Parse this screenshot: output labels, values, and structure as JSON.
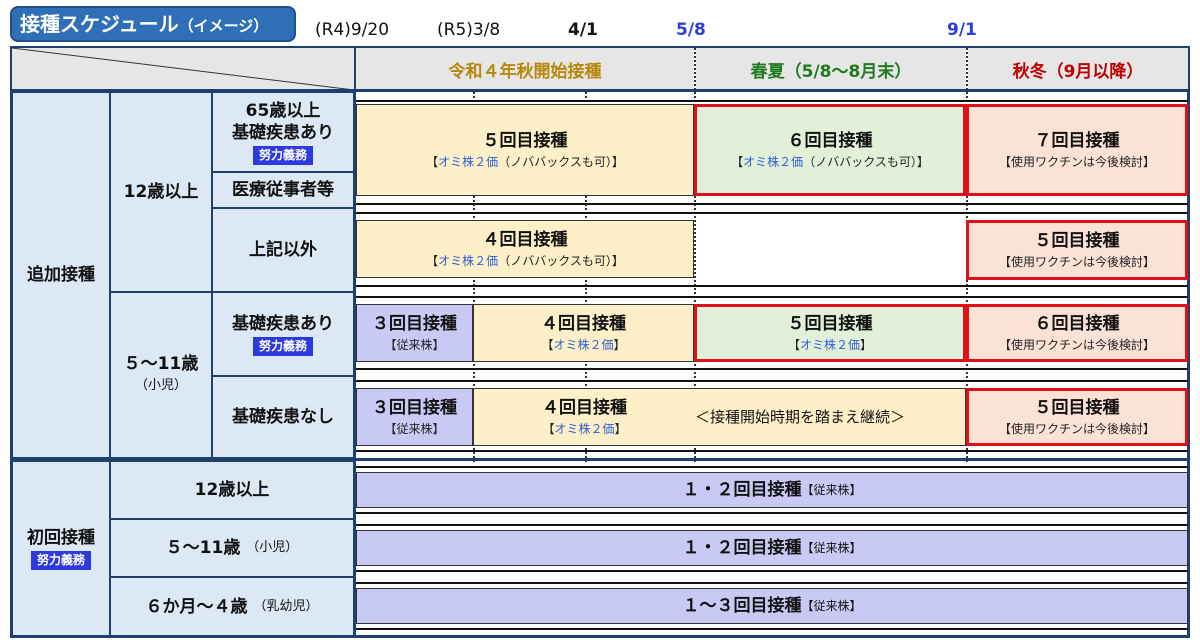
{
  "title": {
    "main": "接種スケジュール",
    "sub": "（イメージ）"
  },
  "dates": {
    "d1": "(R4)9/20",
    "d2": "(R5)3/8",
    "d3": "4/1",
    "d4": "5/8",
    "d5": "9/1"
  },
  "headers": {
    "h1": "令和４年秋開始接種",
    "h2": "春夏（5/8～8月末）",
    "h3": "秋冬（9月以降）"
  },
  "colors": {
    "h1": "#b8860b",
    "h2": "#1e7a1e",
    "h3": "#c00000",
    "badge": "#2d3ae0",
    "blue_date": "#2b3fd6"
  },
  "groups": {
    "booster": "追加接種",
    "age12": "12歳以上",
    "elder": "65歳以上",
    "underlying": "基礎疾患あり",
    "effort": "努力義務",
    "medical": "医療従事者等",
    "others": "上記以外",
    "age5_11": "５～11歳",
    "child": "（小児）",
    "kid_yes": "基礎疾患あり",
    "kid_no": "基礎疾患なし",
    "primary": "初回接種",
    "p12": "12歳以上",
    "p5": "５～11歳",
    "p5note": "（小児）",
    "p6m": "６か月～４歳",
    "p6mnote": "（乳幼児）"
  },
  "bars": {
    "dose5": "５回目接種",
    "dose6": "６回目接種",
    "dose7": "７回目接種",
    "dose4": "４回目接種",
    "dose3": "３回目接種",
    "omi_a": "【",
    "omi_b": "オミ株２価",
    "omi_c": "（ノババックスも可）】",
    "omi2_a": "【",
    "omi2_b": "オミ株２価",
    "omi2_c": "】",
    "tbd": "【使用ワクチンは今後検討】",
    "conv": "【従来株】",
    "cont": "＜接種開始時期を踏まえ継続＞",
    "primary12": "１・２回目接種",
    "primary6m": "１～３回目接種"
  }
}
